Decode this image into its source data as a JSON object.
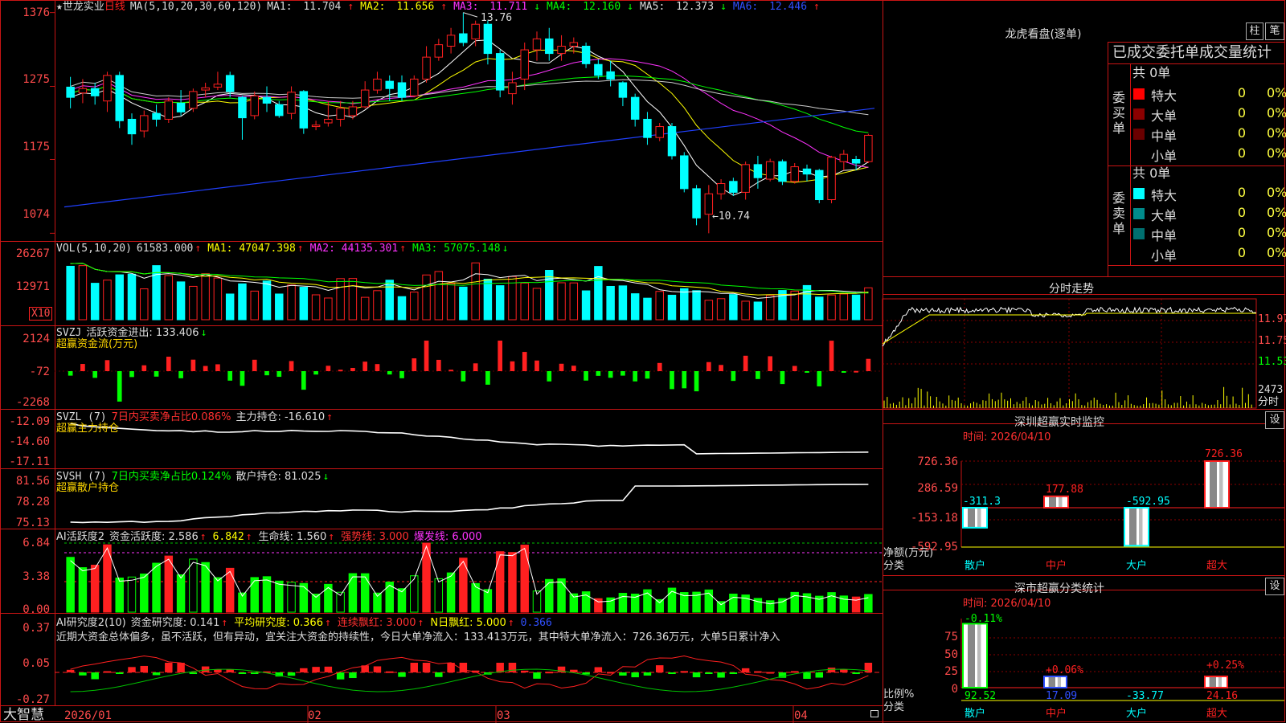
{
  "colors": {
    "up": "#ff2020",
    "down": "#00ffff",
    "panel_border": "#d01010",
    "grid": "#8b0000"
  },
  "price_panel": {
    "title_star": "★",
    "stock_name": "世龙实业",
    "period": "日线",
    "ma_def": "MA(5,10,20,30,60,120)",
    "ma1_label": "MA1:",
    "ma1_value": "11.704",
    "ma2_label": "MA2:",
    "ma2_value": "11.656",
    "ma3_label": "MA3:",
    "ma3_value": "11.711",
    "ma4_label": "MA4:",
    "ma4_value": "12.160",
    "ma5_label": "MA5:",
    "ma5_value": "12.373",
    "ma6_label": "MA6:",
    "ma6_value": "12.446",
    "y_ticks": [
      "1376",
      "1275",
      "1175",
      "1074"
    ],
    "high_label": "13.76",
    "low_label": "←10.74"
  },
  "vol_panel": {
    "title": "VOL(5,10,20)",
    "value": "61583.000",
    "ma1": "MA1: 47047.398",
    "ma2": "MA2: 44135.301",
    "ma3": "MA3: 57075.148",
    "y_ticks": [
      "26267",
      "12971"
    ],
    "unit": "X10"
  },
  "svzj_panel": {
    "title": "SVZJ",
    "line1": "活跃资金进出: 133.406",
    "line2": "超赢资金流(万元)",
    "y_ticks": [
      "2124",
      "-72",
      "-2268"
    ]
  },
  "svzl_panel": {
    "title": "SVZL (7)",
    "ratio": "7日内买卖净占比0.086%",
    "hold": "主力持仓: -16.610",
    "line2": "超赢主力持仓",
    "y_ticks": [
      "-12.09",
      "-14.60",
      "-17.11"
    ]
  },
  "svsh_panel": {
    "title": "SVSH (7)",
    "ratio": "7日内买卖净占比0.124%",
    "hold": "散户持仓: 81.025",
    "line2": "超赢散户持仓",
    "y_ticks": [
      "81.56",
      "78.28",
      "75.13"
    ]
  },
  "ai_active_panel": {
    "title": "AI活跃度2",
    "a": "资金活跃度: 2.586",
    "b": "6.842",
    "c": "生命线: 1.560",
    "d": "强势线: 3.000",
    "e": "爆发线: 6.000",
    "y_ticks": [
      "6.84",
      "3.38",
      "0.00"
    ]
  },
  "ai_research_panel": {
    "title": "AI研究度2(10)",
    "a": "资金研究度: 0.141",
    "b": "平均研究度: 0.366",
    "c": "连续飘红: 3.000",
    "d": "N日飘红: 5.000",
    "e": "0.366",
    "comment": "近期大资金总体偏多，虽不活跃，但有异动，宜关注大资金的持续性，今日大单净流入：133.413万元，其中特大单净流入：726.36万元，大单5日累计净入",
    "y_ticks": [
      "0.37",
      "0.05",
      "-0.27"
    ]
  },
  "x_axis": {
    "logo": "大智慧",
    "labels": [
      "2026/01",
      "02",
      "03",
      "04"
    ]
  },
  "dragon_tiger": {
    "title": "龙虎看盘(逐单)",
    "btn1": "柱",
    "btn2": "笔",
    "stats_title": "已成交委托单成交量统计",
    "buy_total": "共 0单",
    "buy_label": "委买单",
    "sell_total": "共 0单",
    "sell_label": "委卖单",
    "buy_rows": [
      {
        "name": "特大",
        "count": "0",
        "pct": "0%",
        "color": "#ff0000"
      },
      {
        "name": "大单",
        "count": "0",
        "pct": "0%",
        "color": "#8b0000"
      },
      {
        "name": "中单",
        "count": "0",
        "pct": "0%",
        "color": "#6a0000"
      },
      {
        "name": "小单",
        "count": "0",
        "pct": "0%",
        "color": "#000000"
      }
    ],
    "sell_rows": [
      {
        "name": "特大",
        "count": "0",
        "pct": "0%",
        "color": "#00ffff"
      },
      {
        "name": "大单",
        "count": "0",
        "pct": "0%",
        "color": "#008b8b"
      },
      {
        "name": "中单",
        "count": "0",
        "pct": "0%",
        "color": "#007070"
      },
      {
        "name": "小单",
        "count": "0",
        "pct": "0%",
        "color": "#000000"
      }
    ]
  },
  "intraday": {
    "title": "分时走势",
    "y_ticks": [
      "11.97",
      "11.75",
      "11.53"
    ],
    "vol_label": "2473",
    "vol_unit": "分时"
  },
  "sz_monitor": {
    "title": "深圳超赢实时监控",
    "btn": "设",
    "time": "时间: 2026/04/10",
    "y_ticks": [
      "726.36",
      "286.59",
      "-153.18",
      "-592.95"
    ],
    "axis_label": "净额(万元)",
    "cat_label": "分类",
    "categories": [
      "散户",
      "中户",
      "大户",
      "超大"
    ],
    "values": [
      -311.3,
      177.88,
      -592.95,
      726.36
    ],
    "value_labels": [
      "-311.3",
      "177.88",
      "-592.95",
      "726.36"
    ]
  },
  "sz_classify": {
    "title": "深市超赢分类统计",
    "btn": "设",
    "time": "时间: 2026/04/10",
    "y_ticks": [
      "75",
      "50",
      "25",
      "0"
    ],
    "axis_label": "比例%",
    "cat_label": "分类",
    "categories": [
      "散户",
      "中户",
      "大户",
      "超大"
    ],
    "pct_labels": [
      "-0.11%",
      "+0.06%",
      "",
      "+0.25%"
    ],
    "values": [
      92.52,
      17.09,
      -33.77,
      24.16
    ],
    "value_labels": [
      "92.52",
      "17.09",
      "-33.77",
      "24.16"
    ]
  },
  "chart_data": {
    "type": "candlestick",
    "candles_note": "",
    "candles": [
      {
        "o": 12.74,
        "c": 12.6,
        "h": 12.88,
        "l": 12.45
      },
      {
        "o": 12.66,
        "c": 12.72,
        "h": 12.85,
        "l": 12.52
      },
      {
        "o": 12.72,
        "c": 12.62,
        "h": 12.8,
        "l": 12.5
      },
      {
        "o": 12.55,
        "c": 12.9,
        "h": 12.95,
        "l": 12.4
      },
      {
        "o": 12.9,
        "c": 12.28,
        "h": 12.95,
        "l": 12.18
      },
      {
        "o": 12.3,
        "c": 12.1,
        "h": 12.38,
        "l": 11.95
      },
      {
        "o": 12.14,
        "c": 12.35,
        "h": 12.42,
        "l": 12.05
      },
      {
        "o": 12.38,
        "c": 12.3,
        "h": 12.5,
        "l": 12.2
      },
      {
        "o": 12.3,
        "c": 12.55,
        "h": 12.6,
        "l": 12.25
      },
      {
        "o": 12.52,
        "c": 12.4,
        "h": 12.7,
        "l": 12.35
      },
      {
        "o": 12.45,
        "c": 12.68,
        "h": 12.72,
        "l": 12.4
      },
      {
        "o": 12.7,
        "c": 12.73,
        "h": 12.8,
        "l": 12.6
      },
      {
        "o": 12.74,
        "c": 12.78,
        "h": 12.95,
        "l": 12.7
      },
      {
        "o": 12.9,
        "c": 12.68,
        "h": 12.95,
        "l": 12.6
      },
      {
        "o": 12.6,
        "c": 12.32,
        "h": 12.62,
        "l": 12.02
      },
      {
        "o": 12.35,
        "c": 12.62,
        "h": 12.68,
        "l": 12.3
      },
      {
        "o": 12.6,
        "c": 12.52,
        "h": 12.75,
        "l": 12.4
      },
      {
        "o": 12.5,
        "c": 12.35,
        "h": 12.55,
        "l": 12.32
      },
      {
        "o": 12.38,
        "c": 12.67,
        "h": 12.75,
        "l": 12.3
      },
      {
        "o": 12.68,
        "c": 12.18,
        "h": 12.7,
        "l": 12.1
      },
      {
        "o": 12.2,
        "c": 12.22,
        "h": 12.28,
        "l": 12.15
      },
      {
        "o": 12.25,
        "c": 12.3,
        "h": 12.55,
        "l": 12.2
      },
      {
        "o": 12.3,
        "c": 12.45,
        "h": 12.55,
        "l": 12.2
      },
      {
        "o": 12.35,
        "c": 12.47,
        "h": 12.55,
        "l": 12.3
      },
      {
        "o": 12.47,
        "c": 12.7,
        "h": 12.82,
        "l": 12.45
      },
      {
        "o": 12.7,
        "c": 12.85,
        "h": 12.95,
        "l": 12.65
      },
      {
        "o": 12.82,
        "c": 12.72,
        "h": 12.9,
        "l": 12.55
      },
      {
        "o": 12.8,
        "c": 12.6,
        "h": 12.9,
        "l": 12.55
      },
      {
        "o": 12.62,
        "c": 12.85,
        "h": 12.9,
        "l": 12.6
      },
      {
        "o": 12.85,
        "c": 13.15,
        "h": 13.3,
        "l": 12.8
      },
      {
        "o": 13.15,
        "c": 13.32,
        "h": 13.4,
        "l": 13.1
      },
      {
        "o": 13.3,
        "c": 13.45,
        "h": 13.55,
        "l": 13.2
      },
      {
        "o": 13.47,
        "c": 13.35,
        "h": 13.76,
        "l": 13.3
      },
      {
        "o": 13.4,
        "c": 13.6,
        "h": 13.65,
        "l": 13.3
      },
      {
        "o": 13.6,
        "c": 13.2,
        "h": 13.65,
        "l": 13.05
      },
      {
        "o": 13.2,
        "c": 12.7,
        "h": 13.25,
        "l": 12.6
      },
      {
        "o": 12.65,
        "c": 12.8,
        "h": 12.95,
        "l": 12.5
      },
      {
        "o": 12.85,
        "c": 13.25,
        "h": 13.35,
        "l": 12.7
      },
      {
        "o": 13.25,
        "c": 13.4,
        "h": 13.5,
        "l": 13.1
      },
      {
        "o": 13.4,
        "c": 13.2,
        "h": 13.55,
        "l": 13.1
      },
      {
        "o": 13.2,
        "c": 13.3,
        "h": 13.45,
        "l": 13.1
      },
      {
        "o": 13.3,
        "c": 13.35,
        "h": 13.42,
        "l": 13.2
      },
      {
        "o": 13.3,
        "c": 13.06,
        "h": 13.35,
        "l": 13.0
      },
      {
        "o": 13.05,
        "c": 12.9,
        "h": 13.12,
        "l": 12.85
      },
      {
        "o": 12.95,
        "c": 12.85,
        "h": 13.1,
        "l": 12.75
      },
      {
        "o": 12.8,
        "c": 12.6,
        "h": 12.82,
        "l": 12.48
      },
      {
        "o": 12.6,
        "c": 12.3,
        "h": 12.65,
        "l": 12.2
      },
      {
        "o": 12.3,
        "c": 12.05,
        "h": 12.4,
        "l": 11.95
      },
      {
        "o": 12.05,
        "c": 12.2,
        "h": 12.25,
        "l": 12.0
      },
      {
        "o": 12.2,
        "c": 11.8,
        "h": 12.25,
        "l": 11.75
      },
      {
        "o": 11.8,
        "c": 11.35,
        "h": 11.85,
        "l": 11.3
      },
      {
        "o": 11.35,
        "c": 10.95,
        "h": 11.4,
        "l": 10.85
      },
      {
        "o": 11.0,
        "c": 11.28,
        "h": 11.4,
        "l": 10.74
      },
      {
        "o": 11.28,
        "c": 11.42,
        "h": 11.48,
        "l": 11.2
      },
      {
        "o": 11.45,
        "c": 11.3,
        "h": 11.5,
        "l": 11.25
      },
      {
        "o": 11.3,
        "c": 11.68,
        "h": 11.72,
        "l": 11.2
      },
      {
        "o": 11.68,
        "c": 11.5,
        "h": 11.8,
        "l": 11.35
      },
      {
        "o": 11.48,
        "c": 11.72,
        "h": 11.76,
        "l": 11.45
      },
      {
        "o": 11.72,
        "c": 11.45,
        "h": 11.75,
        "l": 11.4
      },
      {
        "o": 11.45,
        "c": 11.65,
        "h": 11.7,
        "l": 11.42
      },
      {
        "o": 11.62,
        "c": 11.55,
        "h": 11.68,
        "l": 11.45
      },
      {
        "o": 11.6,
        "c": 11.2,
        "h": 11.62,
        "l": 11.15
      },
      {
        "o": 11.2,
        "c": 11.78,
        "h": 11.8,
        "l": 11.15
      },
      {
        "o": 11.72,
        "c": 11.82,
        "h": 11.88,
        "l": 11.6
      },
      {
        "o": 11.75,
        "c": 11.7,
        "h": 11.8,
        "l": 11.6
      },
      {
        "o": 11.72,
        "c": 12.08,
        "h": 12.1,
        "l": 11.7
      }
    ],
    "ylim": [
      10.7,
      13.8
    ]
  }
}
